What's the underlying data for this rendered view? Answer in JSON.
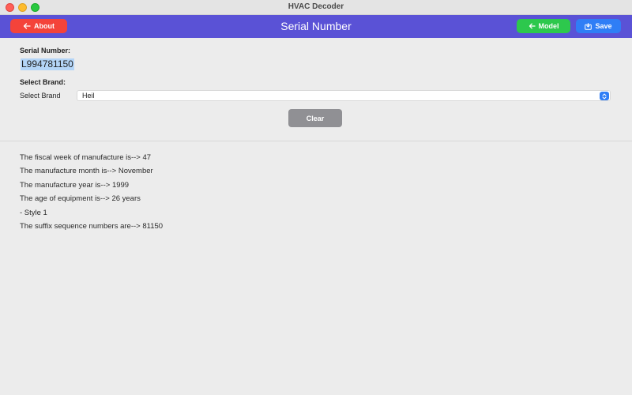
{
  "window": {
    "title": "HVAC Decoder"
  },
  "header": {
    "title": "Serial Number",
    "about_label": "About",
    "model_label": "Model",
    "save_label": "Save"
  },
  "form": {
    "serial_label": "Serial Number:",
    "serial_value": "L994781150",
    "brand_heading": "Select Brand:",
    "brand_label": "Select Brand",
    "brand_value": "Heil",
    "clear_label": "Clear"
  },
  "results": [
    "The fiscal week of manufacture is--> 47",
    "The manufacture month is--> November",
    "The manufacture year is--> 1999",
    "The age of equipment is--> 26 years",
    "- Style 1",
    "The suffix sequence numbers are--> 81150"
  ],
  "icons": {
    "about": "arrow-left-icon",
    "model": "arrow-left-icon",
    "save": "save-icon",
    "select": "chevron-updown-icon"
  },
  "colors": {
    "header": "#5a52d6",
    "about": "#f4433a",
    "model": "#2dc84d",
    "save": "#2f7ef6",
    "clear": "#909094"
  }
}
